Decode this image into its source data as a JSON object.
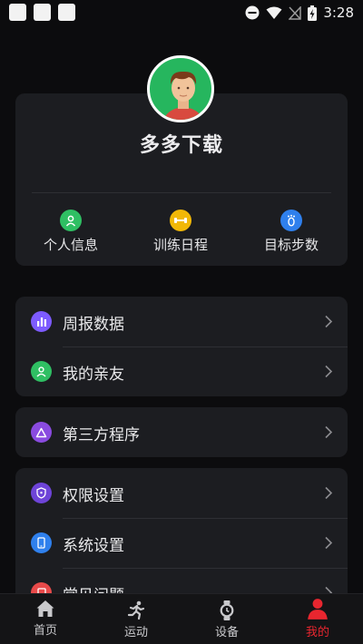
{
  "status_bar": {
    "time": "3:28"
  },
  "profile": {
    "username": "多多下载",
    "quick_actions": [
      {
        "label": "个人信息",
        "icon": "person-icon",
        "color": "#2fbf63"
      },
      {
        "label": "训练日程",
        "icon": "dumbbell-icon",
        "color": "#f2b807"
      },
      {
        "label": "目标步数",
        "icon": "footprint-icon",
        "color": "#2f80ed"
      }
    ]
  },
  "menu": {
    "weekly_report": "周报数据",
    "my_friends": "我的亲友",
    "third_party": "第三方程序",
    "permissions": "权限设置",
    "system_settings": "系统设置",
    "faq": "常见问题"
  },
  "icon_colors": {
    "weekly_report": "#7d5bff",
    "my_friends": "#2fbf63",
    "third_party": "#8a4be0",
    "permissions": "#6e44d8",
    "system_settings": "#2f80ed",
    "faq": "#e84a4a"
  },
  "tabbar": {
    "home": "首页",
    "sport": "运动",
    "device": "设备",
    "mine": "我的",
    "active_color": "#e8262f"
  }
}
